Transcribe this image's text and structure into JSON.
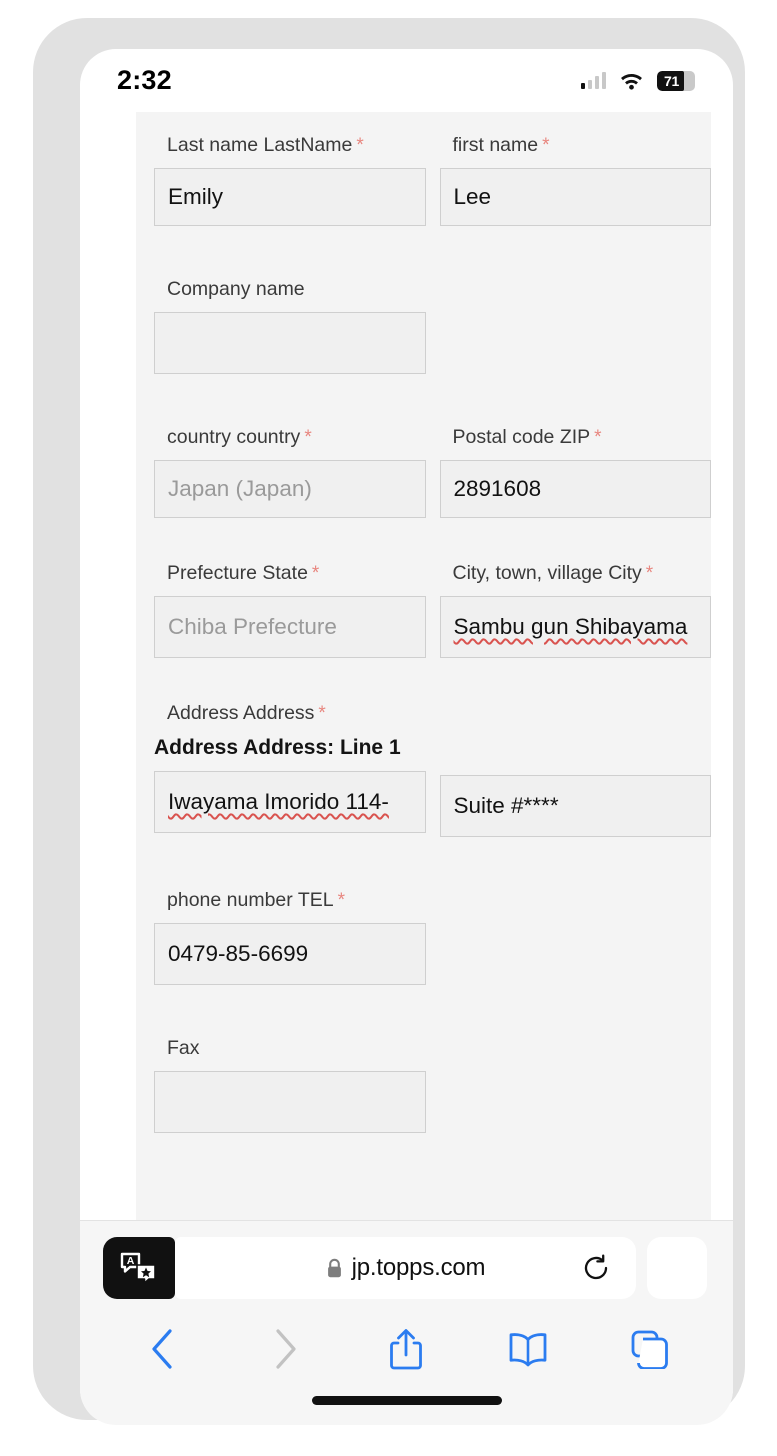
{
  "status_bar": {
    "time": "2:32",
    "battery_level": "71",
    "signal_icon": "cellular-signal-icon",
    "wifi_icon": "wifi-icon",
    "battery_icon": "battery-icon"
  },
  "form": {
    "fields": [
      {
        "label": "Last name LastName",
        "required": "*",
        "value": "Emily",
        "placeholder": "",
        "state": "filled"
      },
      {
        "label": "first name",
        "required": "*",
        "value": "Lee",
        "placeholder": "",
        "state": "filled"
      },
      {
        "label": "Company name",
        "required": "",
        "value": "",
        "placeholder": "",
        "state": "empty"
      },
      {
        "label": "country country",
        "required": "*",
        "value": "Japan (Japan)",
        "placeholder": "Japan (Japan)",
        "state": "placeholder"
      },
      {
        "label": "Postal code ZIP",
        "required": "*",
        "value": "2891608",
        "placeholder": "",
        "state": "filled"
      },
      {
        "label": "Prefecture State",
        "required": "*",
        "value": "Chiba Prefecture",
        "placeholder": "Chiba Prefecture",
        "state": "placeholder"
      },
      {
        "label": "City, town, village City",
        "required": "*",
        "value": "Sambu gun Shibayama",
        "placeholder": "",
        "state": "filled-spellcheck"
      },
      {
        "label": "Address Address",
        "required": "*",
        "value": "",
        "placeholder": "",
        "state": "group-label"
      },
      {
        "label": "Address Address: Line 1",
        "required": "",
        "value": "Iwayama Imorido 114-",
        "placeholder": "",
        "state": "filled-spellcheck"
      },
      {
        "label": "",
        "required": "",
        "value": "Suite #****",
        "placeholder": "",
        "state": "filled"
      },
      {
        "label": "phone number TEL",
        "required": "*",
        "value": "0479-85-6699",
        "placeholder": "",
        "state": "filled"
      },
      {
        "label": "Fax",
        "required": "",
        "value": "",
        "placeholder": "",
        "state": "empty"
      }
    ]
  },
  "browser": {
    "url": "jp.topps.com",
    "lock_icon": "lock-icon",
    "reload_icon": "reload-icon",
    "translate_icon": "translate-icon",
    "toolbar": [
      {
        "name": "back",
        "icon": "chevron-left-icon",
        "enabled": true
      },
      {
        "name": "forward",
        "icon": "chevron-right-icon",
        "enabled": false
      },
      {
        "name": "share",
        "icon": "share-icon",
        "enabled": true
      },
      {
        "name": "bookmarks",
        "icon": "book-icon",
        "enabled": true
      },
      {
        "name": "tabs",
        "icon": "tabs-icon",
        "enabled": true
      }
    ]
  },
  "colors": {
    "accent": "#2b7cf0",
    "required_marker": "#e8867f",
    "spellcheck_underline": "#d9534f",
    "frame": "#e1e1e1",
    "form_bg": "#f4f4f4",
    "input_bg": "#f0f0f0"
  }
}
